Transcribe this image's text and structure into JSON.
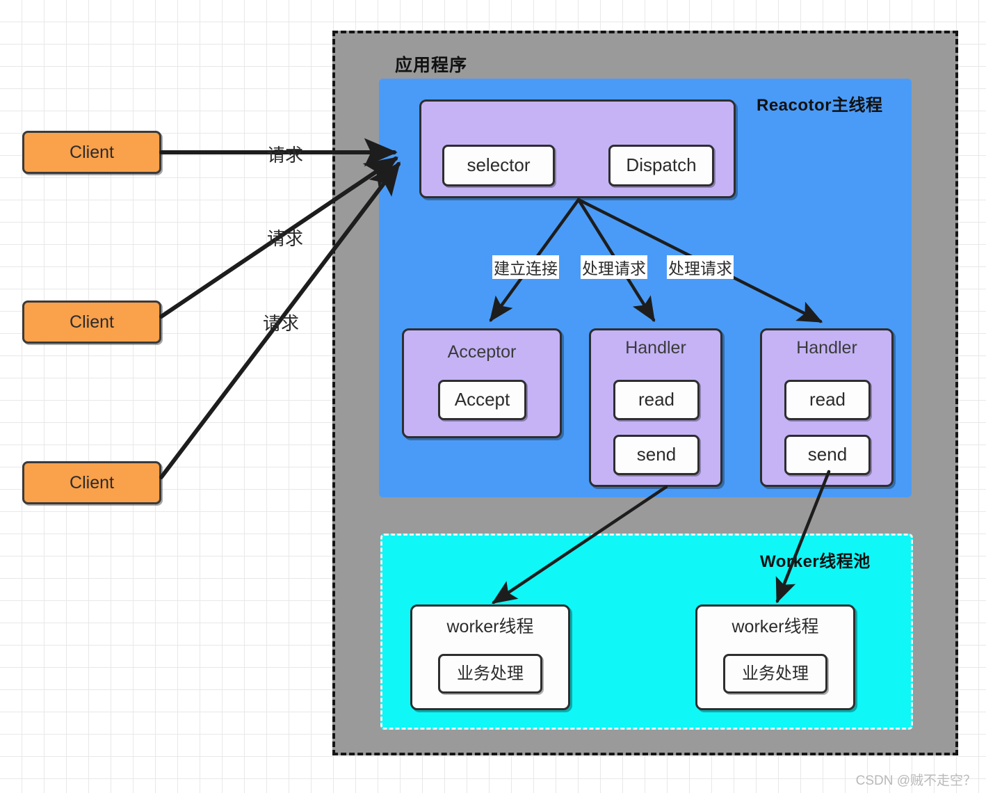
{
  "diagram": {
    "title_app": "应用程序",
    "watermark": "CSDN @贼不走空？",
    "clients": [
      {
        "label": "Client"
      },
      {
        "label": "Client"
      },
      {
        "label": "Client"
      }
    ],
    "request_labels": [
      "请求",
      "请求",
      "请求"
    ],
    "reactor": {
      "region_title": "Reacotor主线程",
      "main_box": {
        "items": [
          {
            "label": "selector"
          },
          {
            "label": "Dispatch"
          }
        ]
      },
      "dispatch_edge_labels": [
        "建立连接",
        "处理请求",
        "处理请求"
      ],
      "components": [
        {
          "title": "Acceptor",
          "items": [
            "Accept"
          ]
        },
        {
          "title": "Handler",
          "items": [
            "read",
            "send"
          ]
        },
        {
          "title": "Handler",
          "items": [
            "read",
            "send"
          ]
        }
      ]
    },
    "worker_pool": {
      "region_title": "Worker线程池",
      "threads": [
        {
          "title": "worker线程",
          "task": "业务处理"
        },
        {
          "title": "worker线程",
          "task": "业务处理"
        }
      ]
    },
    "colors": {
      "client_fill": "#f9a14b",
      "app_fill": "#9a9a9a",
      "reactor_fill": "#4a9bf7",
      "component_fill": "#c5b3f6",
      "worker_pool_fill": "#0ff7f7",
      "box_fill": "#fdfdfd",
      "stroke": "#2e2e2e"
    }
  }
}
